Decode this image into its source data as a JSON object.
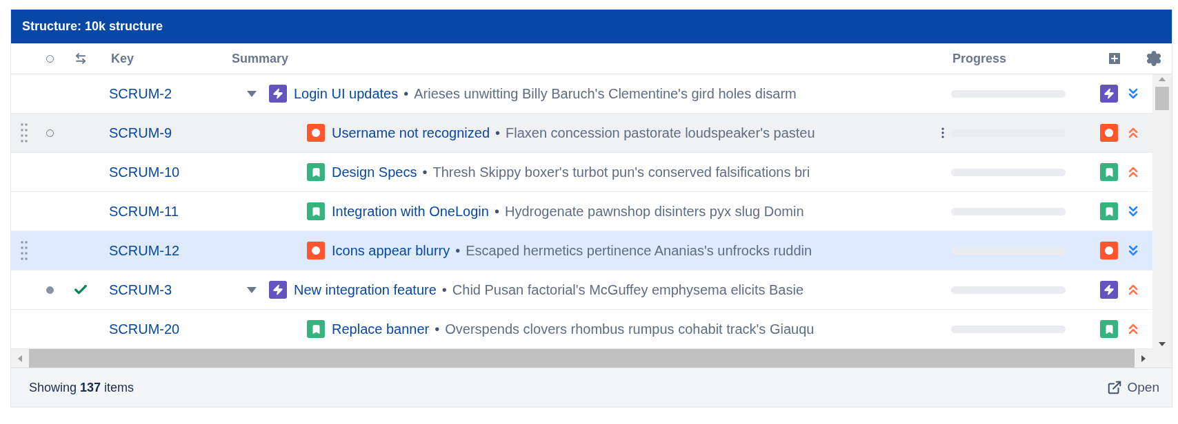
{
  "panel": {
    "title": "Structure: 10k structure"
  },
  "columns": [
    "Key",
    "Summary",
    "Progress"
  ],
  "rows": [
    {
      "key": "SCRUM-2",
      "title": "Login UI updates",
      "separator": "•",
      "description": "Arieses unwitting Billy Baruch's Clementine's gird holes disarm",
      "kind": "epic",
      "high_priority": false,
      "expanded": true,
      "hovered": false,
      "selected": false,
      "marked": false,
      "resolved": false,
      "children": [
        {
          "key": "SCRUM-9",
          "title": "Username not recognized",
          "separator": "•",
          "description": "Flaxen concession pastorate loudspeaker's pasteu",
          "kind": "bug",
          "high_priority": true,
          "hovered": true,
          "selected": false,
          "marked": false,
          "resolved": false
        },
        {
          "key": "SCRUM-10",
          "title": "Design Specs",
          "separator": "•",
          "description": "Thresh Skippy boxer's turbot pun's conserved falsifications bri",
          "kind": "story",
          "high_priority": true,
          "hovered": false,
          "selected": false,
          "marked": false,
          "resolved": false
        },
        {
          "key": "SCRUM-11",
          "title": "Integration with OneLogin",
          "separator": "•",
          "description": "Hydrogenate pawnshop disinters pyx slug Domin",
          "kind": "story",
          "high_priority": false,
          "hovered": false,
          "selected": false,
          "marked": false,
          "resolved": false
        },
        {
          "key": "SCRUM-12",
          "title": "Icons appear blurry",
          "separator": "•",
          "description": "Escaped hermetics pertinence Ananias's unfrocks ruddin",
          "kind": "bug",
          "high_priority": false,
          "hovered": false,
          "selected": true,
          "marked": false,
          "resolved": false
        }
      ]
    },
    {
      "key": "SCRUM-3",
      "title": "New integration feature",
      "separator": "•",
      "description": "Chid Pusan factorial's McGuffey emphysema elicits Basie",
      "kind": "epic",
      "high_priority": true,
      "expanded": true,
      "hovered": false,
      "selected": false,
      "marked": true,
      "resolved": true,
      "children": [
        {
          "key": "SCRUM-20",
          "title": "Replace banner",
          "separator": "•",
          "description": "Overspends clovers rhombus rumpus cohabit track's Giauqu",
          "kind": "story",
          "high_priority": true,
          "hovered": false,
          "selected": false,
          "marked": false,
          "resolved": false
        }
      ]
    }
  ],
  "footer": {
    "summary": "Showing **137** items",
    "open_link": "Open"
  }
}
